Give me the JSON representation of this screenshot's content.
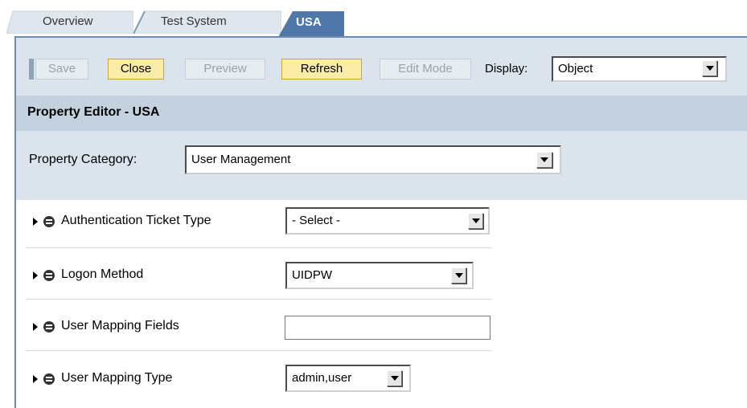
{
  "tabs": [
    {
      "label": "Overview"
    },
    {
      "label": "Test System"
    },
    {
      "label": "USA"
    }
  ],
  "toolbar": {
    "save_label": "Save",
    "close_label": "Close",
    "preview_label": "Preview",
    "refresh_label": "Refresh",
    "edit_mode_label": "Edit Mode",
    "display_label": "Display:",
    "display_value": "Object"
  },
  "editor": {
    "title": "Property Editor - USA",
    "category_label": "Property Category:",
    "category_value": "User Management"
  },
  "properties": [
    {
      "label": "Authentication Ticket Type",
      "control": "select",
      "value": "- Select -"
    },
    {
      "label": "Logon Method",
      "control": "select",
      "value": "UIDPW"
    },
    {
      "label": "User Mapping Fields",
      "control": "text",
      "value": ""
    },
    {
      "label": "User Mapping Type",
      "control": "select",
      "value": "admin,user"
    }
  ],
  "colors": {
    "active_tab": "#4f78a8",
    "toolbar_bg": "#dbe4ed",
    "header_bg": "#c4d2df",
    "enabled_button": "#fbeca7"
  }
}
